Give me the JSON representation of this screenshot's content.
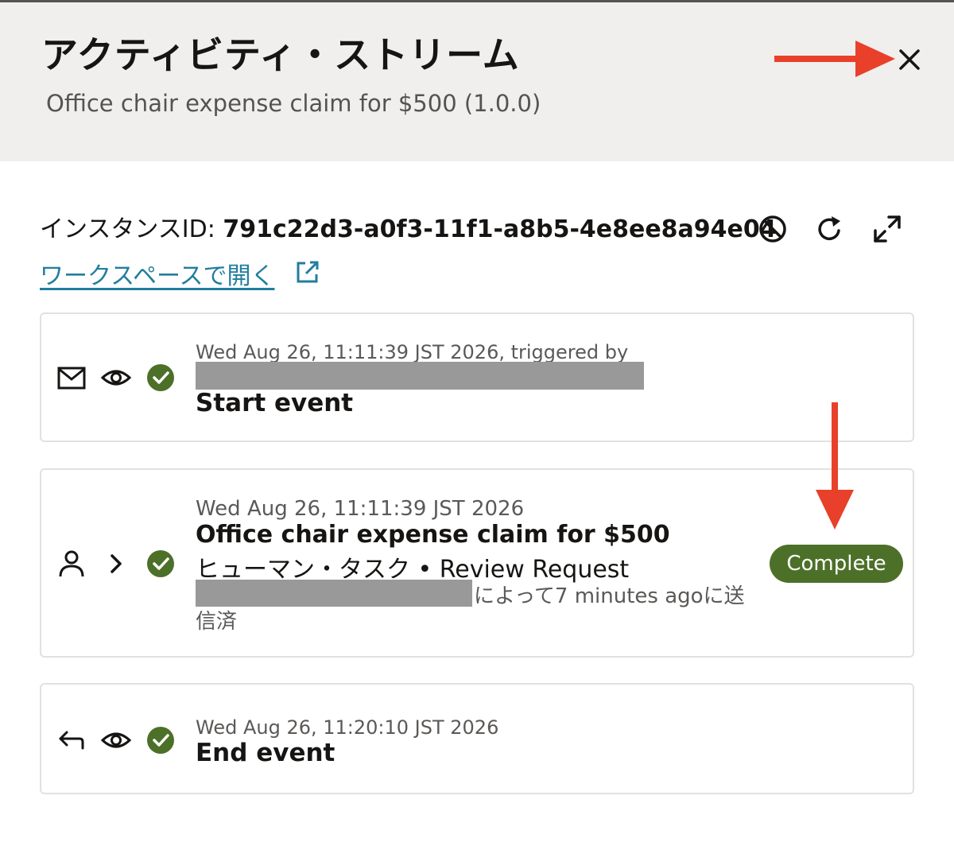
{
  "header": {
    "title": "アクティビティ・ストリーム",
    "subtitle": "Office chair expense claim for $500 (1.0.0)"
  },
  "instance": {
    "label": "インスタンスID: ",
    "id": "791c22d3-a0f3-11f1-a8b5-4e8ee8a94e04",
    "workspace_link": "ワークスペースで開く"
  },
  "icons": {
    "close": "close-icon",
    "cancel": "block-icon",
    "refresh": "refresh-icon",
    "expand": "expand-icon",
    "external": "external-link-icon"
  },
  "events": [
    {
      "type": "start",
      "timestamp": "Wed Aug 26, 11:11:39 JST 2026, triggered by",
      "title": "Start event",
      "icons": [
        "mail-icon",
        "eye-icon",
        "check-circle-icon"
      ]
    },
    {
      "type": "human-task",
      "timestamp": "Wed Aug 26, 11:11:39 JST 2026",
      "title": "Office chair expense claim for $500",
      "subtitle": "ヒューマン・タスク • Review Request",
      "submitted_suffix": "によって7 minutes agoに送",
      "submitted_wrap": "信済",
      "status": "Complete",
      "icons": [
        "person-icon",
        "chevron-right-icon",
        "check-circle-icon"
      ]
    },
    {
      "type": "end",
      "timestamp": "Wed Aug 26, 11:20:10 JST 2026",
      "title": "End event",
      "icons": [
        "arrow-left-icon",
        "eye-icon",
        "check-circle-icon"
      ]
    }
  ],
  "colors": {
    "header_bg": "#f1efed",
    "success": "#4d7029",
    "link": "#227e9e",
    "annotation_arrow": "#e8402a",
    "redaction": "#999999"
  }
}
